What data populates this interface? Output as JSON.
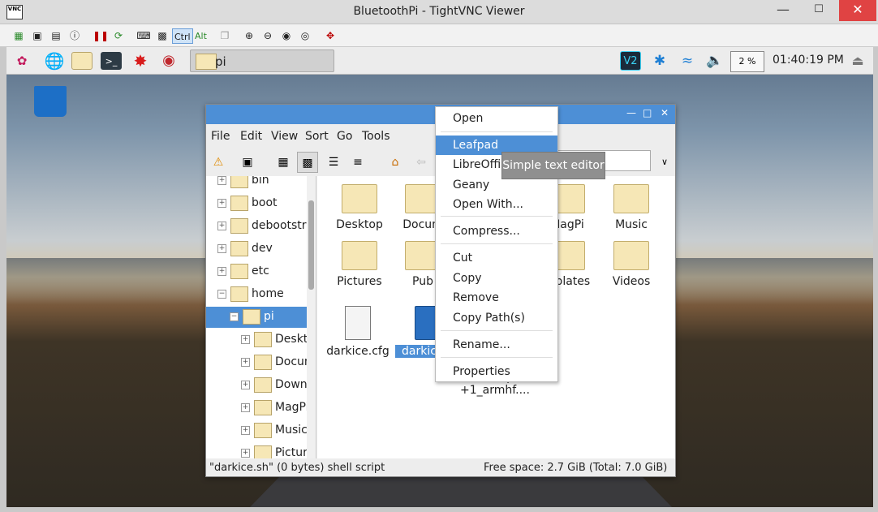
{
  "window": {
    "title": "BluetoothPi - TightVNC Viewer",
    "logo": "VNC"
  },
  "vnc_toolbar": {
    "ctrl": "Ctrl",
    "alt": "Alt"
  },
  "panel": {
    "task": "pi",
    "cpu": "2 %",
    "clock": "01:40:19 PM"
  },
  "fm": {
    "menu": [
      "File",
      "Edit",
      "View",
      "Sort",
      "Go",
      "Tools"
    ],
    "tree": [
      {
        "label": "bin",
        "expanded": false
      },
      {
        "label": "boot",
        "expanded": false
      },
      {
        "label": "debootstrap",
        "expanded": false
      },
      {
        "label": "dev",
        "expanded": false
      },
      {
        "label": "etc",
        "expanded": false
      },
      {
        "label": "home",
        "expanded": true
      },
      {
        "label": "pi",
        "expanded": true,
        "selected": true
      },
      {
        "label": "Desktop"
      },
      {
        "label": "Documents"
      },
      {
        "label": "Downloads"
      },
      {
        "label": "MagPi"
      },
      {
        "label": "Music"
      },
      {
        "label": "Pictures"
      }
    ],
    "items": [
      {
        "label": "Desktop",
        "kind": "folder"
      },
      {
        "label": "Docum",
        "kind": "folder"
      },
      {
        "label": "MagPi",
        "kind": "folder"
      },
      {
        "label": "Music",
        "kind": "folder"
      },
      {
        "label": "Pictures",
        "kind": "folder"
      },
      {
        "label": "Pub",
        "kind": "folder"
      },
      {
        "label": "mplates",
        "kind": "folder"
      },
      {
        "label": "Videos",
        "kind": "folder"
      },
      {
        "label": "darkice.cfg",
        "kind": "doc"
      },
      {
        "label": "darkice.sh",
        "kind": "script"
      },
      {
        "label": "darkice_1.0.\n1-999~mp3\n+1_armhf....",
        "kind": "pkg"
      }
    ],
    "status_left": "\"darkice.sh\" (0 bytes) shell script",
    "status_right": "Free space: 2.7 GiB (Total: 7.0 GiB)"
  },
  "context_menu": {
    "items": [
      "Open",
      "Leafpad",
      "LibreOffic",
      "Geany",
      "Open With...",
      "Compress...",
      "Cut",
      "Copy",
      "Remove",
      "Copy Path(s)",
      "Rename...",
      "Properties"
    ],
    "highlighted": "Leafpad"
  },
  "tooltip": "Simple text editor"
}
